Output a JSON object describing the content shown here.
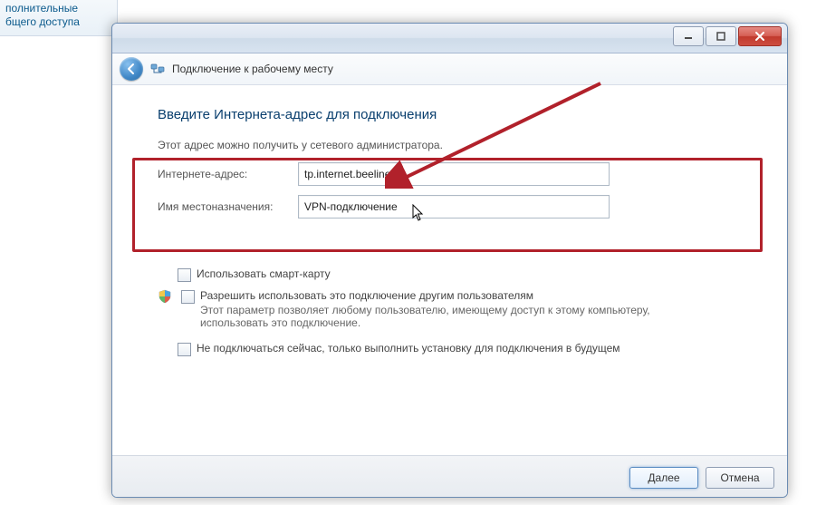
{
  "bg": {
    "line1": "полнительные",
    "line2": "бщего доступа"
  },
  "header": {
    "title": "Подключение к рабочему месту"
  },
  "page": {
    "heading": "Введите Интернета-адрес для подключения",
    "subtext": "Этот адрес можно получить у сетевого администратора."
  },
  "form": {
    "address_label": "Интернете-адрес:",
    "address_value": "tp.internet.beeline.ru",
    "destname_label": "Имя местоназначения:",
    "destname_value": "VPN-подключение"
  },
  "checks": {
    "smartcard": "Использовать смарт-карту",
    "allow_others": "Разрешить использовать это подключение другим пользователям",
    "allow_others_sub": "Этот параметр позволяет любому пользователю, имеющему доступ к этому компьютеру, использовать это подключение.",
    "no_connect_now": "Не подключаться сейчас, только выполнить установку для подключения в будущем"
  },
  "buttons": {
    "next": "Далее",
    "cancel": "Отмена"
  },
  "icons": {
    "back": "back-arrow-icon",
    "network": "network-places-icon",
    "shield": "uac-shield-icon",
    "minimize": "minimize-icon",
    "maximize": "maximize-icon",
    "close": "close-icon"
  },
  "colors": {
    "heading": "#0a3f6e",
    "annotation": "#b1212b"
  }
}
